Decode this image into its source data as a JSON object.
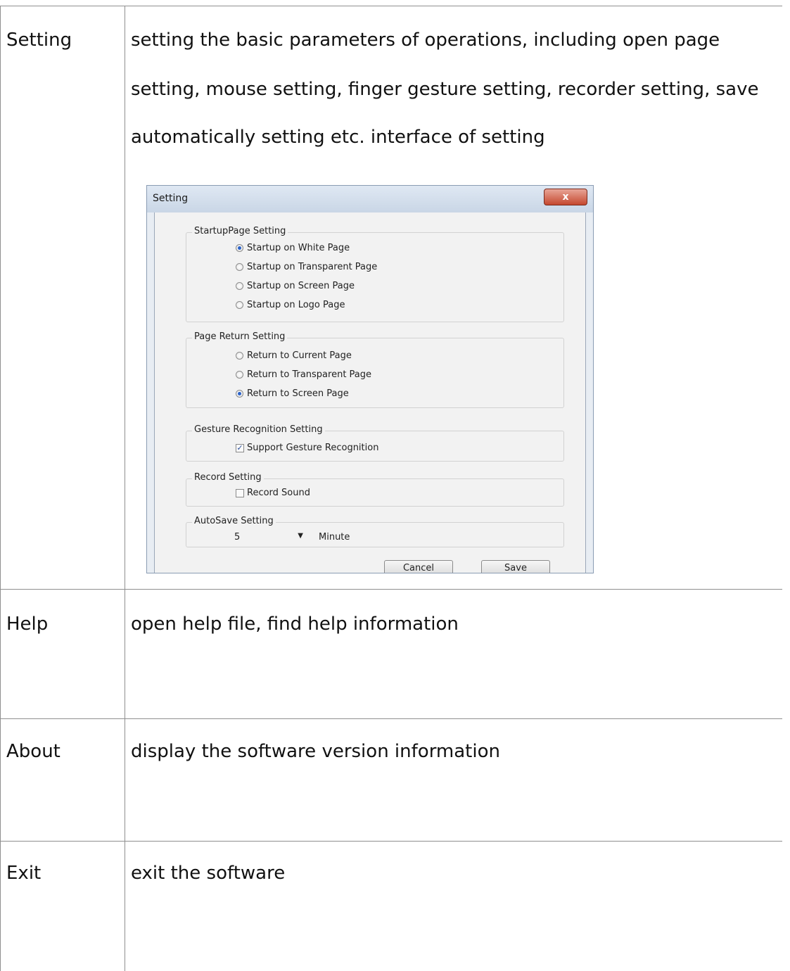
{
  "rows": [
    {
      "label": "Setting",
      "lines": [
        "setting the basic parameters of operations, including open page",
        "setting, mouse setting, finger gesture setting, recorder setting, save",
        "automatically setting etc. interface of setting"
      ]
    },
    {
      "label": "Help",
      "text": "open help file, find help information"
    },
    {
      "label": "About",
      "text": "display the software version information"
    },
    {
      "label": "Exit",
      "text": "exit the software"
    }
  ],
  "dialog": {
    "title": "Setting",
    "close_label": "x",
    "startup_group": {
      "title": "StartupPage Setting",
      "options": [
        {
          "label": "Startup on White Page",
          "selected": true
        },
        {
          "label": "Startup on Transparent Page",
          "selected": false
        },
        {
          "label": "Startup on Screen Page",
          "selected": false
        },
        {
          "label": "Startup on Logo Page",
          "selected": false
        }
      ]
    },
    "return_group": {
      "title": "Page Return Setting",
      "options": [
        {
          "label": "Return to Current Page",
          "selected": false
        },
        {
          "label": "Return to Transparent Page",
          "selected": false
        },
        {
          "label": "Return to Screen Page",
          "selected": true
        }
      ]
    },
    "gesture_group": {
      "title": "Gesture Recognition Setting",
      "checkbox_label": "Support Gesture Recognition",
      "checked": true
    },
    "record_group": {
      "title": "Record Setting",
      "checkbox_label": "Record Sound",
      "checked": false
    },
    "autosave_group": {
      "title": "AutoSave Setting",
      "value": "5",
      "unit": "Minute"
    },
    "cancel_label": "Cancel",
    "save_label": "Save"
  }
}
